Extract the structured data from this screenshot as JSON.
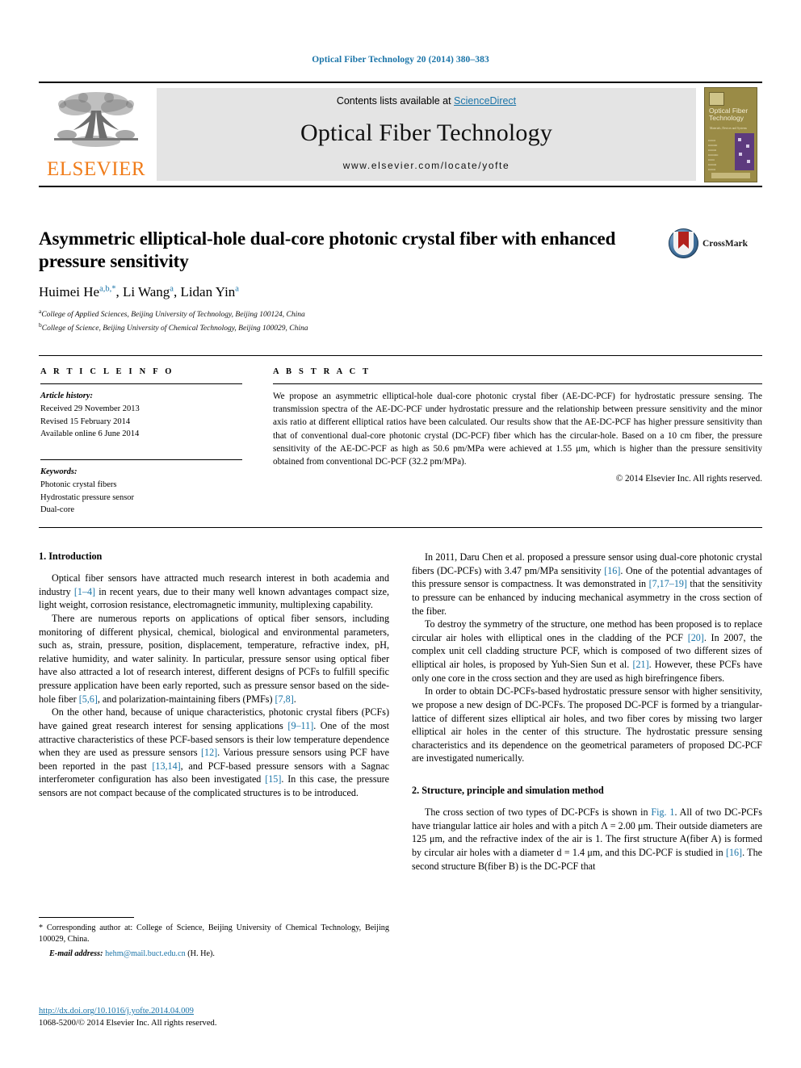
{
  "running_head": "Optical Fiber Technology 20 (2014) 380–383",
  "masthead": {
    "elsevier_wordmark": "ELSEVIER",
    "contents_prefix": "Contents lists available at ",
    "sciencedirect": "ScienceDirect",
    "journal_name": "Optical Fiber Technology",
    "journal_url": "www.elsevier.com/locate/yofte",
    "cover": {
      "title_line1": "Optical Fiber",
      "title_line2": "Technology",
      "subtitle": "Materials, Devices and Systems"
    }
  },
  "article": {
    "title": "Asymmetric elliptical-hole dual-core photonic crystal fiber with enhanced pressure sensitivity",
    "authors": [
      {
        "name": "Huimei He",
        "marks": "a,b,*"
      },
      {
        "name": "Li Wang",
        "marks": "a"
      },
      {
        "name": "Lidan Yin",
        "marks": "a"
      }
    ],
    "affiliations": [
      {
        "mark": "a",
        "text": "College of Applied Sciences, Beijing University of Technology, Beijing 100124, China"
      },
      {
        "mark": "b",
        "text": "College of Science, Beijing University of Chemical Technology, Beijing 100029, China"
      }
    ],
    "crossmark_label": "CrossMark"
  },
  "info": {
    "heading": "A R T I C L E   I N F O",
    "history_label": "Article history:",
    "history": [
      "Received 29 November 2013",
      "Revised 15 February 2014",
      "Available online 6 June 2014"
    ],
    "keywords_label": "Keywords:",
    "keywords": [
      "Photonic crystal fibers",
      "Hydrostatic pressure sensor",
      "Dual-core"
    ]
  },
  "abstract": {
    "heading": "A B S T R A C T",
    "text": "We propose an asymmetric elliptical-hole dual-core photonic crystal fiber (AE-DC-PCF) for hydrostatic pressure sensing. The transmission spectra of the AE-DC-PCF under hydrostatic pressure and the relationship between pressure sensitivity and the minor axis ratio at different elliptical ratios have been calculated. Our results show that the AE-DC-PCF has higher pressure sensitivity than that of conventional dual-core photonic crystal (DC-PCF) fiber which has the circular-hole. Based on a 10 cm fiber, the pressure sensitivity of the AE-DC-PCF as high as 50.6 pm/MPa were achieved at 1.55 μm, which is higher than the pressure sensitivity obtained from conventional DC-PCF (32.2 pm/MPa).",
    "copyright": "© 2014 Elsevier Inc. All rights reserved."
  },
  "sections": {
    "intro_heading": "1. Introduction",
    "structure_heading": "2. Structure, principle and simulation method"
  },
  "left_column": {
    "p1": "Optical fiber sensors have attracted much research interest in both academia and industry [1–4] in recent years, due to their many well known advantages compact size, light weight, corrosion resistance, electromagnetic immunity, multiplexing capability.",
    "p2": "There are numerous reports on applications of optical fiber sensors, including monitoring of different physical, chemical, biological and environmental parameters, such as, strain, pressure, position, displacement, temperature, refractive index, pH, relative humidity, and water salinity. In particular, pressure sensor using optical fiber have also attracted a lot of research interest, different designs of PCFs to fulfill specific pressure application have been early reported, such as pressure sensor based on the side-hole fiber [5,6], and polarization-maintaining fibers (PMFs) [7,8].",
    "p3": "On the other hand, because of unique characteristics, photonic crystal fibers (PCFs) have gained great research interest for sensing applications [9–11]. One of the most attractive characteristics of these PCF-based sensors is their low temperature dependence when they are used as pressure sensors [12]. Various pressure sensors using PCF have been reported in the past [13,14], and PCF-based pressure sensors with a Sagnac interferometer configuration has also been investigated [15]. In this case, the pressure sensors are not compact because of the complicated structures is to be introduced."
  },
  "right_column": {
    "p1": "In 2011, Daru Chen et al. proposed a pressure sensor using dual-core photonic crystal fibers (DC-PCFs) with 3.47 pm/MPa sensitivity [16]. One of the potential advantages of this pressure sensor is compactness. It was demonstrated in [7,17–19] that the sensitivity to pressure can be enhanced by inducing mechanical asymmetry in the cross section of the fiber.",
    "p2": "To destroy the symmetry of the structure, one method has been proposed is to replace circular air holes with elliptical ones in the cladding of the PCF [20]. In 2007, the complex unit cell cladding structure PCF, which is composed of two different sizes of elliptical air holes, is proposed by Yuh-Sien Sun et al. [21]. However, these PCFs have only one core in the cross section and they are used as high birefringence fibers.",
    "p3": "In order to obtain DC-PCFs-based hydrostatic pressure sensor with higher sensitivity, we propose a new design of DC-PCFs. The proposed DC-PCF is formed by a triangular-lattice of different sizes elliptical air holes, and two fiber cores by missing two larger elliptical air holes in the center of this structure. The hydrostatic pressure sensing characteristics and its dependence on the geometrical parameters of proposed DC-PCF are investigated numerically.",
    "p4": "The cross section of two types of DC-PCFs is shown in Fig. 1. All of two DC-PCFs have triangular lattice air holes and with a pitch Λ = 2.00 μm. Their outside diameters are 125 μm, and the refractive index of the air is 1. The first structure A(fiber A) is formed by circular air holes with a diameter d = 1.4 μm, and this DC-PCF is studied in [16]. The second structure B(fiber B) is the DC-PCF that"
  },
  "footnotes": {
    "corresponding": "* Corresponding author at: College of Science, Beijing University of Chemical Technology, Beijing 100029, China.",
    "email_label": "E-mail address:",
    "email": "hehm@mail.buct.edu.cn",
    "email_suffix": "(H. He).",
    "doi": "http://dx.doi.org/10.1016/j.yofte.2014.04.009",
    "issn_line": "1068-5200/© 2014 Elsevier Inc. All rights reserved."
  },
  "colors": {
    "link": "#1a74a8",
    "elsevier_orange": "#f07c1a",
    "crossmark_red": "#b2221d"
  }
}
